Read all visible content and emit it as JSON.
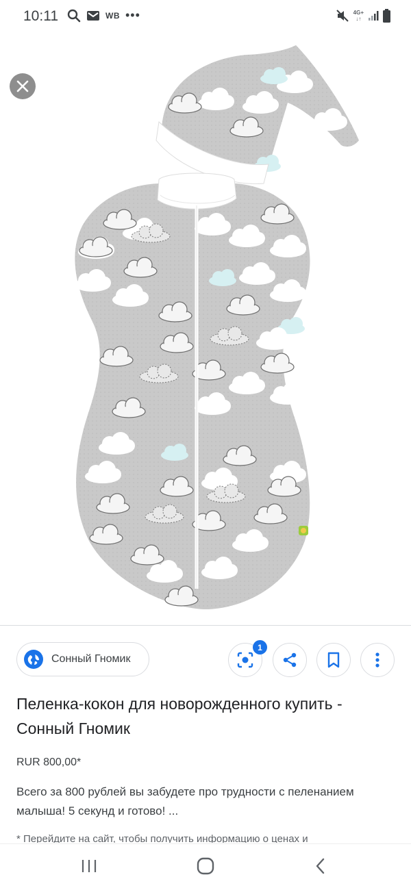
{
  "status_bar": {
    "time": "10:11",
    "carrier_text": "WB",
    "more_dots": "•••",
    "network_label": "4G+",
    "icons": [
      "search-icon",
      "gmail-icon",
      "mute-icon",
      "signal-icon",
      "battery-icon"
    ]
  },
  "image_viewer": {
    "close_icon": "close-icon",
    "image_subject": "grey swaddle cocoon with cloud print and matching hat"
  },
  "actions": {
    "source_label": "Сонный Гномик",
    "lens_badge_count": "1",
    "buttons": [
      "lens-icon",
      "share-icon",
      "bookmark-icon",
      "more-vert-icon"
    ],
    "accent_color": "#1a73e8"
  },
  "result": {
    "title": "Пеленка-кокон для новорожденного купить - Сонный Гномик",
    "price": "RUR 800,00*",
    "description": "Всего за 800 рублей вы забудете про трудности с пеленанием малыша! 5 секунд и готово! ...",
    "note": "* Перейдите на сайт, чтобы получить информацию о ценах и"
  },
  "nav_bar": {
    "buttons": [
      "recents-icon",
      "home-icon",
      "back-icon"
    ]
  }
}
